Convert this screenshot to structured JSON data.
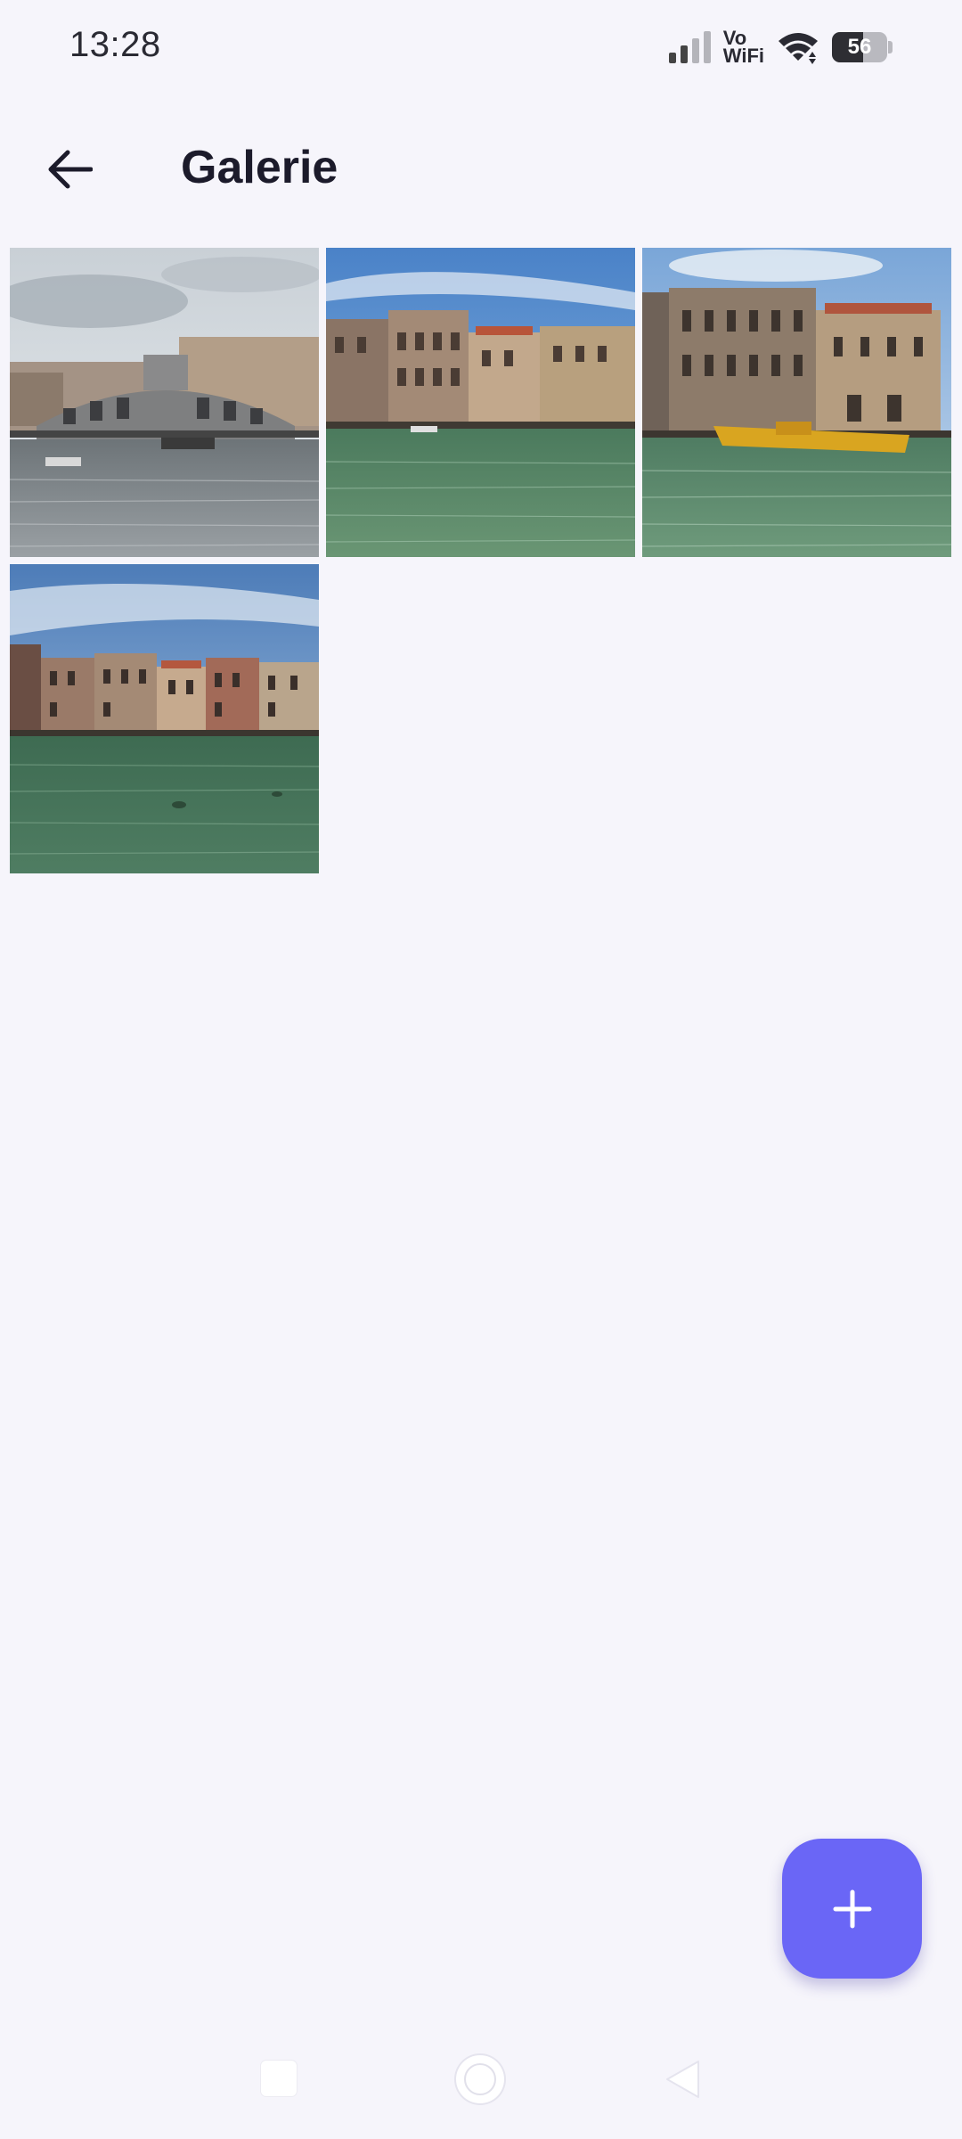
{
  "status_bar": {
    "time": "13:28",
    "network_label_top": "Vo",
    "network_label_bottom": "WiFi",
    "battery_level": "56",
    "battery_fraction": 0.56,
    "icons": [
      "signal-icon",
      "vowifi-icon",
      "wifi-icon",
      "battery-icon"
    ]
  },
  "app_bar": {
    "title": "Galerie",
    "back_icon": "arrow-left-icon"
  },
  "gallery": {
    "photos": [
      {
        "subject": "bridge-over-canal"
      },
      {
        "subject": "canal-palazzi-blue-sky"
      },
      {
        "subject": "canal-palazzi-yellow-boat"
      },
      {
        "subject": "canal-buildings-green-water"
      }
    ]
  },
  "fab": {
    "icon": "plus-icon"
  },
  "navigation_bar": {
    "icons": [
      "recents-icon",
      "home-icon",
      "back-triangle-icon"
    ]
  },
  "colors": {
    "background": "#f6f5fb",
    "accent": "#6a66f6",
    "title_text": "#1c1b2b"
  }
}
